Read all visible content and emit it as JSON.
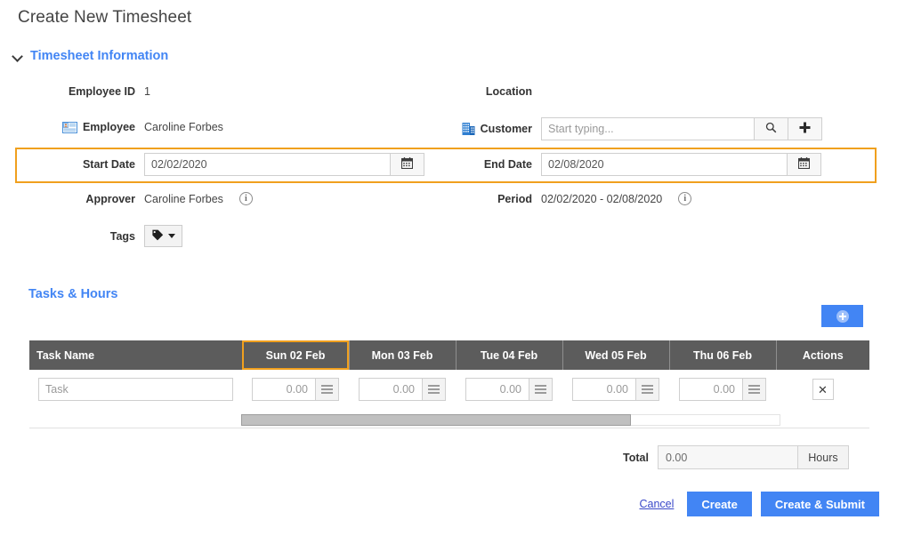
{
  "page": {
    "title": "Create New Timesheet"
  },
  "sections": {
    "timesheet_information": "Timesheet Information",
    "tasks_hours": "Tasks & Hours"
  },
  "form": {
    "employee_id": {
      "label": "Employee ID",
      "value": "1"
    },
    "location": {
      "label": "Location",
      "value": ""
    },
    "employee": {
      "label": "Employee",
      "value": "Caroline Forbes",
      "icon": "id-card-icon"
    },
    "customer": {
      "label": "Customer",
      "value": "",
      "placeholder": "Start typing...",
      "icon": "building-icon",
      "search_icon": "search-icon",
      "add_icon": "plus-icon"
    },
    "start_date": {
      "label": "Start Date",
      "value": "02/02/2020",
      "icon": "calendar-icon"
    },
    "end_date": {
      "label": "End Date",
      "value": "02/08/2020",
      "icon": "calendar-icon"
    },
    "approver": {
      "label": "Approver",
      "value": "Caroline Forbes",
      "info_icon": "info-icon",
      "info_glyph": "i"
    },
    "period": {
      "label": "Period",
      "value": "02/02/2020 - 02/08/2020",
      "info_icon": "info-icon",
      "info_glyph": "i"
    },
    "tags": {
      "label": "Tags",
      "icon": "tag-icon"
    }
  },
  "table": {
    "add_row_button": {
      "name": "add-row-button",
      "icon": "plus-circle-icon"
    },
    "columns": [
      {
        "key": "task",
        "label": "Task Name",
        "selected": false
      },
      {
        "key": "sun02",
        "label": "Sun 02 Feb",
        "selected": true
      },
      {
        "key": "mon03",
        "label": "Mon 03 Feb",
        "selected": false
      },
      {
        "key": "tue04",
        "label": "Tue 04 Feb",
        "selected": false
      },
      {
        "key": "wed05",
        "label": "Wed 05 Feb",
        "selected": false
      },
      {
        "key": "thu06",
        "label": "Thu 06 Feb",
        "selected": false
      },
      {
        "key": "actions",
        "label": "Actions",
        "selected": false
      }
    ],
    "rows": [
      {
        "task": {
          "value": "",
          "placeholder": "Task"
        },
        "hours": [
          {
            "day": "Sun 02 Feb",
            "value": "0.00"
          },
          {
            "day": "Mon 03 Feb",
            "value": "0.00"
          },
          {
            "day": "Tue 04 Feb",
            "value": "0.00"
          },
          {
            "day": "Wed 05 Feb",
            "value": "0.00"
          },
          {
            "day": "Thu 06 Feb",
            "value": "0.00"
          }
        ],
        "delete_label": "✕"
      }
    ],
    "scrollbar": {
      "orientation": "horizontal",
      "thumb_position_pct": 0,
      "visible_fraction_pct": 72
    }
  },
  "total": {
    "label": "Total",
    "value": "0.00",
    "unit": "Hours"
  },
  "footer": {
    "cancel": "Cancel",
    "create": "Create",
    "create_submit": "Create & Submit"
  },
  "colors": {
    "accent_blue": "#4285f4",
    "highlight_orange": "#f0a01e",
    "table_header_gray": "#5c5c5c",
    "link_blue": "#3a49c9"
  }
}
